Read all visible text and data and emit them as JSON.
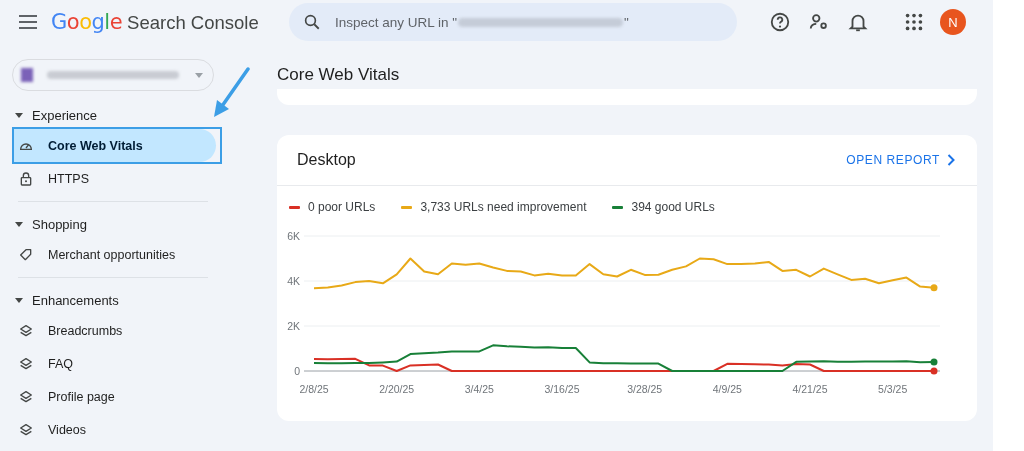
{
  "header": {
    "logo_google": "Google",
    "logo_product": "Search Console",
    "search": {
      "placeholder": "Inspect any URL in \"",
      "placeholder_end": "\""
    },
    "avatar": "N"
  },
  "sidebar": {
    "sections": [
      {
        "label": "Experience",
        "expanded": true,
        "items": [
          {
            "label": "Core Web Vitals",
            "selected": true,
            "highlighted": true
          },
          {
            "label": "HTTPS",
            "selected": false,
            "highlighted": false
          }
        ]
      },
      {
        "label": "Shopping",
        "expanded": true,
        "items": [
          {
            "label": "Merchant opportunities",
            "selected": false,
            "highlighted": false
          }
        ]
      },
      {
        "label": "Enhancements",
        "expanded": true,
        "items": [
          {
            "label": "Breadcrumbs",
            "selected": false,
            "highlighted": false
          },
          {
            "label": "FAQ",
            "selected": false,
            "highlighted": false
          },
          {
            "label": "Profile page",
            "selected": false,
            "highlighted": false
          },
          {
            "label": "Videos",
            "selected": false,
            "highlighted": false
          }
        ]
      }
    ]
  },
  "page_title": "Core Web Vitals",
  "report": {
    "title": "Desktop",
    "link": "OPEN REPORT",
    "chart_data": {
      "type": "line",
      "categories": [
        "2/8/25",
        null,
        null,
        null,
        null,
        null,
        "2/20/25",
        null,
        null,
        null,
        null,
        null,
        "3/4/25",
        null,
        null,
        null,
        null,
        null,
        "3/16/25",
        null,
        null,
        null,
        null,
        null,
        "3/28/25",
        null,
        null,
        null,
        null,
        null,
        "4/9/25",
        null,
        null,
        null,
        null,
        null,
        "4/21/25",
        null,
        null,
        null,
        null,
        null,
        "5/3/25",
        null,
        null,
        null
      ],
      "series": [
        {
          "name": "0 poor URLs",
          "color": "#d93025",
          "values": [
            530,
            520,
            530,
            540,
            250,
            240,
            0,
            250,
            270,
            290,
            0,
            0,
            0,
            0,
            0,
            0,
            0,
            0,
            0,
            0,
            0,
            0,
            0,
            0,
            0,
            0,
            0,
            0,
            0,
            0,
            320,
            310,
            300,
            290,
            250,
            310,
            290,
            0,
            0,
            0,
            0,
            0,
            0,
            0,
            0,
            0
          ]
        },
        {
          "name": "3,733 URLs need improvement",
          "color": "#e8a917",
          "values": [
            3680,
            3710,
            3800,
            3950,
            4000,
            3900,
            4300,
            5000,
            4420,
            4300,
            4780,
            4720,
            4780,
            4600,
            4450,
            4420,
            4250,
            4320,
            4250,
            4250,
            4750,
            4300,
            4200,
            4500,
            4270,
            4280,
            4500,
            4650,
            5000,
            4970,
            4750,
            4760,
            4780,
            4850,
            4450,
            4500,
            4200,
            4550,
            4300,
            4050,
            4100,
            3900,
            4030,
            4150,
            3750,
            3700
          ]
        },
        {
          "name": "394 good URLs",
          "color": "#188038",
          "values": [
            350,
            340,
            345,
            350,
            350,
            380,
            420,
            750,
            790,
            820,
            870,
            870,
            870,
            1140,
            1100,
            1080,
            1050,
            1055,
            1020,
            1020,
            380,
            340,
            340,
            330,
            330,
            330,
            0,
            0,
            0,
            0,
            0,
            0,
            0,
            0,
            0,
            410,
            420,
            430,
            410,
            410,
            420,
            420,
            425,
            430,
            390,
            400
          ]
        }
      ],
      "ylim": [
        0,
        6000
      ],
      "yticks": [
        {
          "value": 0,
          "label": "0"
        },
        {
          "value": 2000,
          "label": "2K"
        },
        {
          "value": 4000,
          "label": "4K"
        },
        {
          "value": 6000,
          "label": "6K"
        }
      ]
    }
  }
}
